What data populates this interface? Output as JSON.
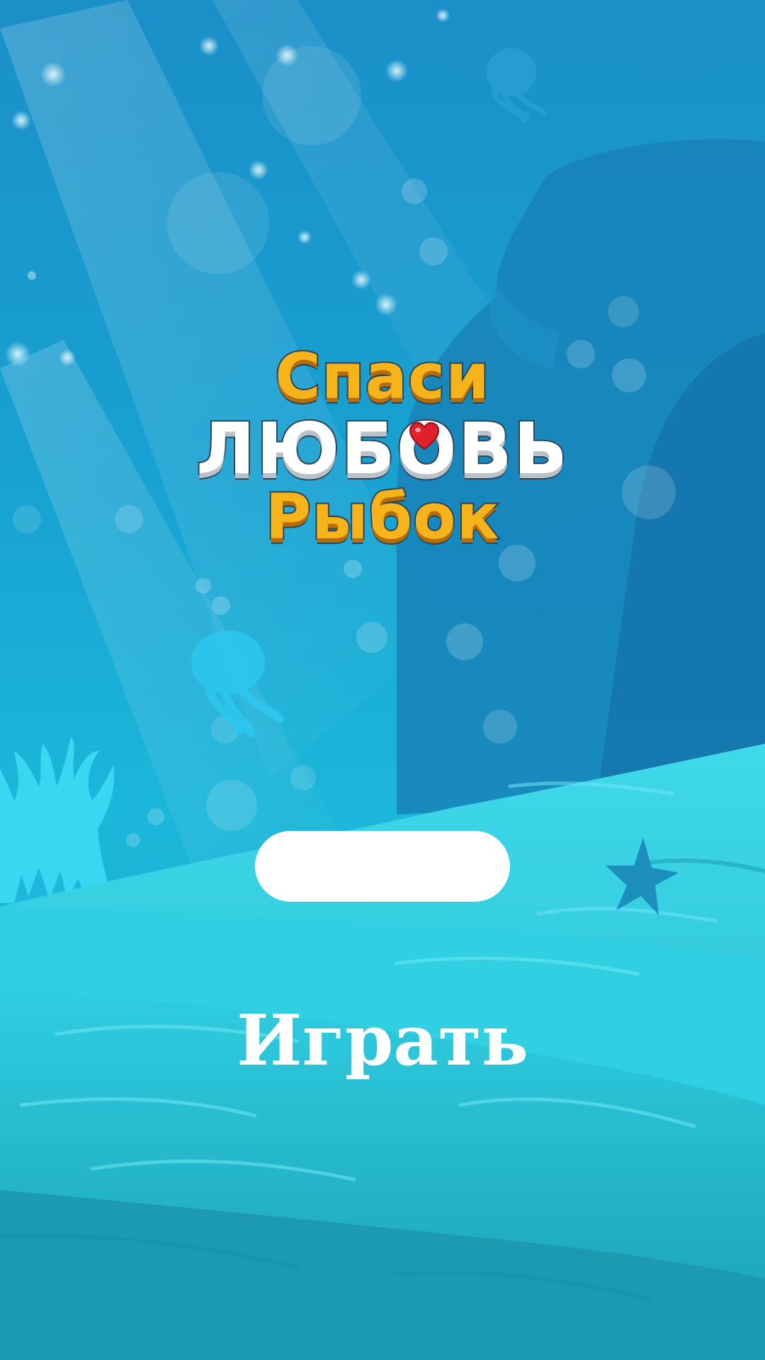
{
  "game": {
    "logo": {
      "line1": "Спаси",
      "line2": "ЛЮБОВЬ",
      "line3": "Рыбок",
      "accent_color": "#f6b31a",
      "outline_color": "#2d4356",
      "heart_color": "#e0202c"
    },
    "name_input": {
      "value": "",
      "placeholder": ""
    },
    "play_button": {
      "label": "Играть"
    },
    "scene": {
      "water_color": "#1a9fd0",
      "sand_color": "#33d4e6",
      "decorations": [
        "jellyfish-icon",
        "jellyfish-icon",
        "coral-icon",
        "starfish-icon",
        "bubble-icon"
      ]
    }
  }
}
